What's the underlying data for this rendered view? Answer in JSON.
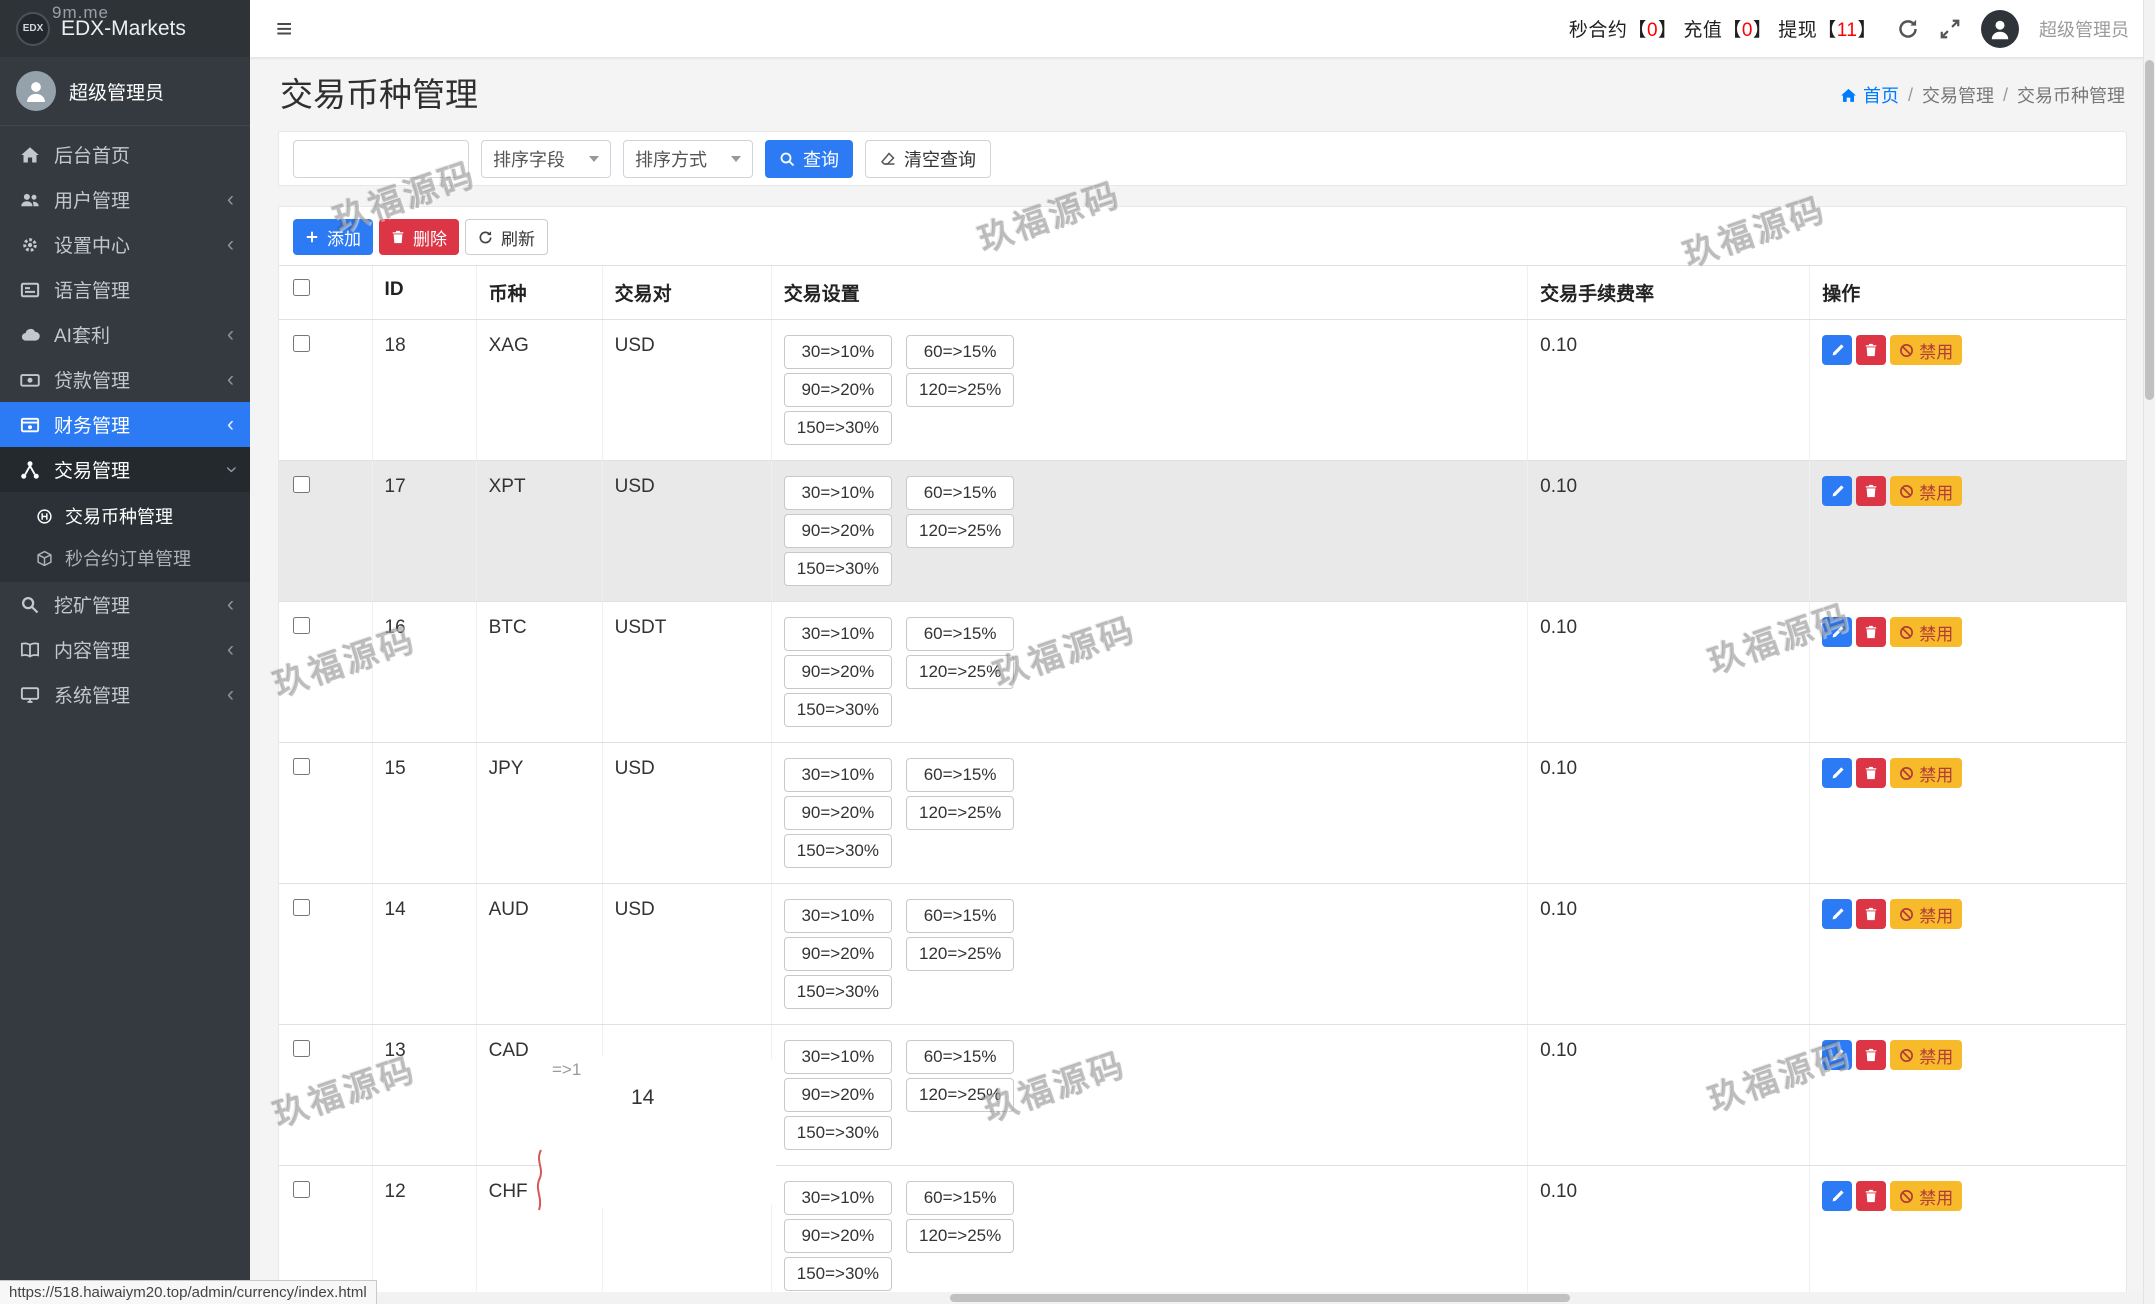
{
  "colors": {
    "primary": "#2d7bf4",
    "danger": "#dc3545",
    "warning": "#f7ba2a",
    "warning-text": "#b23b3b",
    "sidebar-bg": "#343a40",
    "sidebar-dark": "#2e3338",
    "submenu-bg": "#2b3136",
    "content-bg": "#f4f4f4",
    "count-red": "#ff0000",
    "link-blue": "#007bff",
    "row-highlight": "#e9e9e9"
  },
  "corner_note": "9m.me",
  "brand": {
    "logo": "EDX",
    "name": "EDX-Markets"
  },
  "sidebar": {
    "user_name": "超级管理员",
    "menu": [
      {
        "label": "后台首页"
      },
      {
        "label": "用户管理"
      },
      {
        "label": "设置中心"
      },
      {
        "label": "语言管理"
      },
      {
        "label": "AI套利"
      },
      {
        "label": "贷款管理"
      },
      {
        "label": "财务管理"
      },
      {
        "label": "交易管理"
      },
      {
        "label": "挖矿管理"
      },
      {
        "label": "内容管理"
      },
      {
        "label": "系统管理"
      }
    ],
    "submenu": [
      {
        "label": "交易币种管理"
      },
      {
        "label": "秒合约订单管理"
      }
    ]
  },
  "topbar": {
    "notices": [
      {
        "label": "秒合约",
        "count": "0"
      },
      {
        "label": "充值",
        "count": "0"
      },
      {
        "label": "提现",
        "count": "11"
      }
    ],
    "bl": "【",
    "br": "】",
    "user_name": "超级管理员"
  },
  "page": {
    "title": "交易币种管理",
    "breadcrumb": {
      "home": "首页",
      "sep": "/",
      "items": [
        "交易管理",
        "交易币种管理"
      ]
    }
  },
  "filters": {
    "keyword_value": "",
    "sort_field_label": "排序字段",
    "sort_order_label": "排序方式",
    "search_label": "查询",
    "clear_label": "清空查询"
  },
  "toolbar": {
    "add": "添加",
    "delete": "删除",
    "refresh": "刷新"
  },
  "table": {
    "columns": [
      "ID",
      "币种",
      "交易对",
      "交易设置",
      "交易手续费率",
      "操作"
    ],
    "disable_label": "禁用",
    "rows": [
      {
        "id": "18",
        "coin": "XAG",
        "pair": "USD",
        "fee": "0.10",
        "settings": [
          "30=>10%",
          "60=>15%",
          "90=>20%",
          "120=>25%",
          "150=>30%"
        ]
      },
      {
        "id": "17",
        "coin": "XPT",
        "pair": "USD",
        "fee": "0.10",
        "settings": [
          "30=>10%",
          "60=>15%",
          "90=>20%",
          "120=>25%",
          "150=>30%"
        ]
      },
      {
        "id": "16",
        "coin": "BTC",
        "pair": "USDT",
        "fee": "0.10",
        "settings": [
          "30=>10%",
          "60=>15%",
          "90=>20%",
          "120=>25%",
          "150=>30%"
        ]
      },
      {
        "id": "15",
        "coin": "JPY",
        "pair": "USD",
        "fee": "0.10",
        "settings": [
          "30=>10%",
          "60=>15%",
          "90=>20%",
          "120=>25%",
          "150=>30%"
        ]
      },
      {
        "id": "14",
        "coin": "AUD",
        "pair": "USD",
        "fee": "0.10",
        "settings": [
          "30=>10%",
          "60=>15%",
          "90=>20%",
          "120=>25%",
          "150=>30%"
        ]
      },
      {
        "id": "13",
        "coin": "CAD",
        "pair": "",
        "fee": "0.10",
        "settings": [
          "30=>10%",
          "60=>15%",
          "90=>20%",
          "120=>25%",
          "150=>30%"
        ]
      },
      {
        "id": "12",
        "coin": "CHF",
        "pair": "USD",
        "fee": "0.10",
        "settings": [
          "30=>10%",
          "60=>15%",
          "90=>20%",
          "120=>25%",
          "150=>30%"
        ]
      }
    ]
  },
  "watermark": {
    "text": "玖福源码"
  },
  "artifact": {
    "fragment": "=>1",
    "stray_number": "14"
  },
  "statusbar": {
    "url": "https://518.haiwaiym20.top/admin/currency/index.html"
  }
}
